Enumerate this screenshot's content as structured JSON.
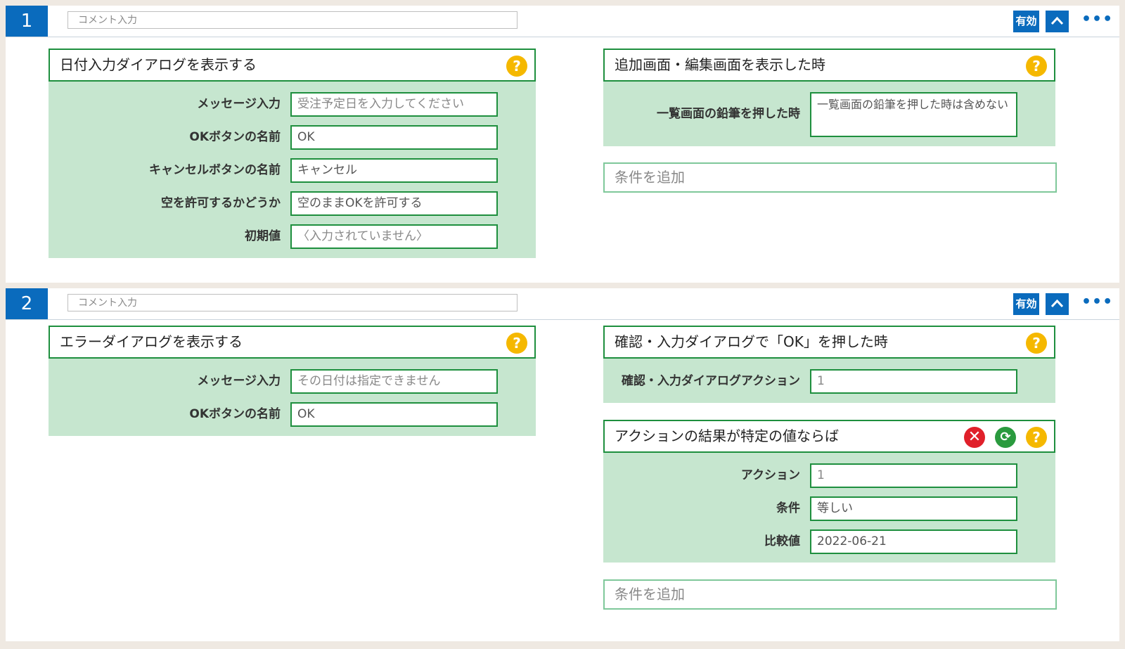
{
  "rules": [
    {
      "number": "1",
      "comment_placeholder": "コメント入力",
      "enabled_label": "有効",
      "more_label": "•••",
      "action": {
        "title": "日付入力ダイアログを表示する",
        "fields": [
          {
            "label": "メッセージ入力",
            "value": "受注予定日を入力してください"
          },
          {
            "label": "OKボタンの名前",
            "value": "OK"
          },
          {
            "label": "キャンセルボタンの名前",
            "value": "キャンセル"
          },
          {
            "label": "空を許可するかどうか",
            "value": "空のままOKを許可する"
          },
          {
            "label": "初期値",
            "value": "〈入力されていません〉"
          }
        ]
      },
      "trigger": {
        "title": "追加画面・編集画面を表示した時",
        "fields": [
          {
            "label": "一覧画面の鉛筆を押した時",
            "value": "一覧画面の鉛筆を押した時は含めない"
          }
        ]
      },
      "add_condition": "条件を追加"
    },
    {
      "number": "2",
      "comment_placeholder": "コメント入力",
      "enabled_label": "有効",
      "more_label": "•••",
      "action": {
        "title": "エラーダイアログを表示する",
        "fields": [
          {
            "label": "メッセージ入力",
            "value": "その日付は指定できません"
          },
          {
            "label": "OKボタンの名前",
            "value": "OK"
          }
        ]
      },
      "trigger": {
        "title": "確認・入力ダイアログで「OK」を押した時",
        "fields": [
          {
            "label": "確認・入力ダイアログアクション",
            "value": "1"
          }
        ]
      },
      "condition": {
        "title": "アクションの結果が特定の値ならば",
        "fields": [
          {
            "label": "アクション",
            "value": "1"
          },
          {
            "label": "条件",
            "value": "等しい"
          },
          {
            "label": "比較値",
            "value": "2022-06-21"
          }
        ]
      },
      "add_condition": "条件を追加"
    }
  ],
  "icons": {
    "help": "question-circle-icon",
    "delete": "close-circle-icon",
    "refresh": "refresh-circle-icon",
    "collapse": "chevron-up-icon"
  },
  "colors": {
    "accent_blue": "#0a6bbd",
    "block_green": "#c6e6cf",
    "border_green": "#1e8f3e",
    "help_yellow": "#f5b800",
    "delete_red": "#e0202a"
  }
}
